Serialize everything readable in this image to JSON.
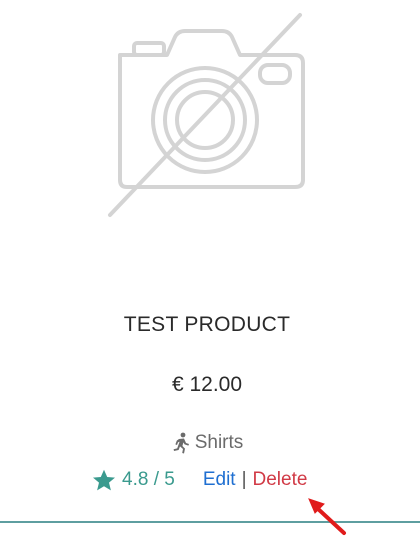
{
  "product": {
    "title": "TEST PRODUCT",
    "price": "€ 12.00",
    "category": "Shirts",
    "rating": "4.8 / 5",
    "image_icon": "no-image-camera-icon",
    "category_icon": "running-person-icon",
    "rating_icon": "star-icon"
  },
  "actions": {
    "edit_label": "Edit",
    "separator": "|",
    "delete_label": "Delete"
  },
  "colors": {
    "rating": "#3a9a8e",
    "edit": "#1f6fd1",
    "delete": "#d13a46",
    "divider": "#5e9ea0",
    "annotation_arrow": "#e01b1b"
  }
}
